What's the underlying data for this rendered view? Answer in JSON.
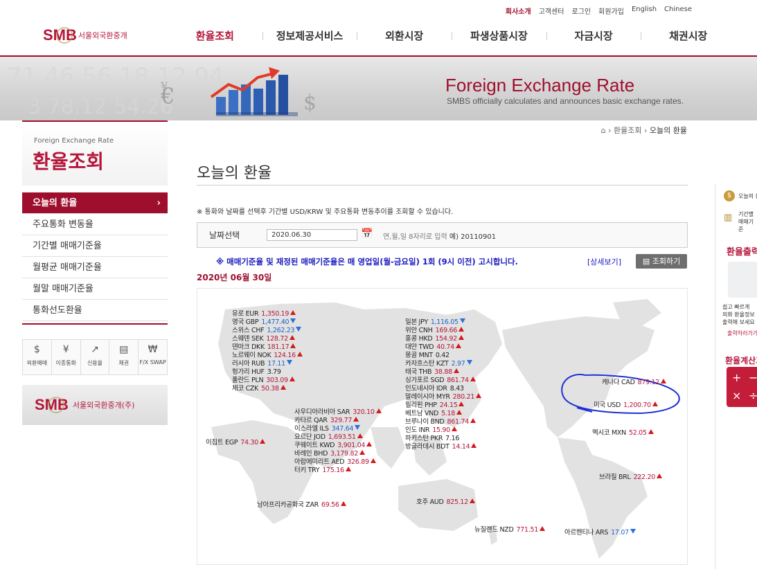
{
  "util_links": [
    "회사소개",
    "고객센터",
    "로그인",
    "회원가입",
    "English",
    "Chinese"
  ],
  "logo": {
    "text": "SMB",
    "sub": "서울외국환중개"
  },
  "gnb": [
    "환율조회",
    "정보제공서비스",
    "외환시장",
    "파생상품시장",
    "자금시장",
    "채권시장"
  ],
  "banner": {
    "title": "Foreign Exchange Rate",
    "subtitle": "SMBS officially calculates and announces basic exchange rates."
  },
  "lnb_head": {
    "en": "Foreign Exchange Rate",
    "kr": "환율조회"
  },
  "lnb": [
    "오늘의 환율",
    "주요통화 변동율",
    "기간별 매매기준율",
    "월평균 매매기준율",
    "월말 매매기준율",
    "통화선도환율"
  ],
  "quick": [
    {
      "label": "외환매매",
      "icon": "currency-trade-icon"
    },
    {
      "label": "이종통화",
      "icon": "cross-currency-icon"
    },
    {
      "label": "신용율",
      "icon": "credit-rate-icon"
    },
    {
      "label": "채권",
      "icon": "bond-icon"
    },
    {
      "label": "F/X SWAP",
      "icon": "fx-swap-icon"
    }
  ],
  "smb_box": {
    "text": "SMB",
    "sub": "서울외국환중개(주)"
  },
  "breadcrumb": [
    "환율조회",
    "오늘의 환율"
  ],
  "page_title": "오늘의 환율",
  "notice": "※ 통화와 날짜를 선택후 기간별 USD/KRW 및 주요통화 변동추이를 조회할 수 있습니다.",
  "date_box": {
    "label": "날짜선택",
    "value": "2020.06.30",
    "hint": "연,월,일 8자리로 입력",
    "example": "예) 20110901"
  },
  "blue_notice": "※ 매매기준율 및 재정된 매매기준율은 매 영업일(월-금요일) 1회 (9시 이전) 고시합니다.",
  "detail_link": "[상세보기]",
  "query_button": "조회하기",
  "announce_date": "2020년 06월 30일",
  "rates": {
    "europe": [
      {
        "name": "유로 EUR",
        "value": "1,350.19",
        "dir": "up"
      },
      {
        "name": "영국 GBP",
        "value": "1,477.40",
        "dir": "down"
      },
      {
        "name": "스위스 CHF",
        "value": "1,262.23",
        "dir": "down"
      },
      {
        "name": "스웨덴 SEK",
        "value": "128.72",
        "dir": "up"
      },
      {
        "name": "덴마크 DKK",
        "value": "181.17",
        "dir": "up"
      },
      {
        "name": "노르웨이 NOK",
        "value": "124.16",
        "dir": "up"
      },
      {
        "name": "러시아 RUB",
        "value": "17.11",
        "dir": "down"
      },
      {
        "name": "헝가리 HUF",
        "value": "3.79",
        "dir": "none"
      },
      {
        "name": "폴란드 PLN",
        "value": "303.09",
        "dir": "up"
      },
      {
        "name": "체코 CZK",
        "value": "50.38",
        "dir": "up"
      }
    ],
    "mideast": [
      {
        "name": "사우디아라비아 SAR",
        "value": "320.10",
        "dir": "up"
      },
      {
        "name": "카타르 QAR",
        "value": "329.77",
        "dir": "up"
      },
      {
        "name": "이스라엘 ILS",
        "value": "347.64",
        "dir": "down"
      },
      {
        "name": "요르단 JOD",
        "value": "1,693.51",
        "dir": "up"
      },
      {
        "name": "쿠웨이트 KWD",
        "value": "3,901.04",
        "dir": "up"
      },
      {
        "name": "바레인 BHD",
        "value": "3,179.82",
        "dir": "up"
      },
      {
        "name": "아랍에미리트 AED",
        "value": "326.89",
        "dir": "up"
      },
      {
        "name": "터키 TRY",
        "value": "175.16",
        "dir": "up"
      }
    ],
    "asia": [
      {
        "name": "일본 JPY",
        "value": "1,116.05",
        "dir": "down"
      },
      {
        "name": "위안 CNH",
        "value": "169.66",
        "dir": "up"
      },
      {
        "name": "홍콩 HKD",
        "value": "154.92",
        "dir": "up"
      },
      {
        "name": "대만 TWD",
        "value": "40.74",
        "dir": "up"
      },
      {
        "name": "몽골 MNT",
        "value": "0.42",
        "dir": "none"
      },
      {
        "name": "카자흐스탄 KZT",
        "value": "2.97",
        "dir": "down"
      },
      {
        "name": "태국 THB",
        "value": "38.88",
        "dir": "up"
      },
      {
        "name": "싱가포르 SGD",
        "value": "861.74",
        "dir": "up"
      },
      {
        "name": "인도네시아 IDR",
        "value": "8.43",
        "dir": "none"
      },
      {
        "name": "말레이시아 MYR",
        "value": "280.21",
        "dir": "up"
      },
      {
        "name": "필리핀 PHP",
        "value": "24.15",
        "dir": "up"
      },
      {
        "name": "베트남 VND",
        "value": "5.18",
        "dir": "up"
      },
      {
        "name": "브루나이 BND",
        "value": "861.74",
        "dir": "up"
      },
      {
        "name": "인도 INR",
        "value": "15.90",
        "dir": "up"
      },
      {
        "name": "파키스탄 PKR",
        "value": "7.16",
        "dir": "none"
      },
      {
        "name": "방글라데시 BDT",
        "value": "14.14",
        "dir": "up"
      }
    ],
    "other": [
      {
        "name": "이집트 EGP",
        "value": "74.30",
        "dir": "up"
      },
      {
        "name": "남아프리카공화국 ZAR",
        "value": "69.56",
        "dir": "up"
      },
      {
        "name": "호주 AUD",
        "value": "825.12",
        "dir": "up"
      },
      {
        "name": "뉴질랜드 NZD",
        "value": "771.51",
        "dir": "up"
      },
      {
        "name": "캐나다 CAD",
        "value": "879.12",
        "dir": "up"
      },
      {
        "name": "미국 USD",
        "value": "1,200.70",
        "dir": "up"
      },
      {
        "name": "멕시코 MXN",
        "value": "52.05",
        "dir": "up"
      },
      {
        "name": "브라질 BRL",
        "value": "222.20",
        "dir": "up"
      },
      {
        "name": "아르헨티나 ARS",
        "value": "17.07",
        "dir": "down"
      }
    ]
  },
  "right_side": {
    "item1": "오늘의 환율",
    "item2a": "기간별",
    "item2b": "매매기준",
    "title1": "환율출력",
    "desc1a": "쉽고 빠르게",
    "desc1b": "외화 환율정보",
    "desc1c": "출력해 보세요",
    "link1": "출력하러가기",
    "title2": "환율계산기"
  },
  "colors": {
    "brand": "#9e0f2e",
    "notice_blue": "#1a1ac0",
    "up": "#d21a1a",
    "down": "#2d6fd6"
  }
}
